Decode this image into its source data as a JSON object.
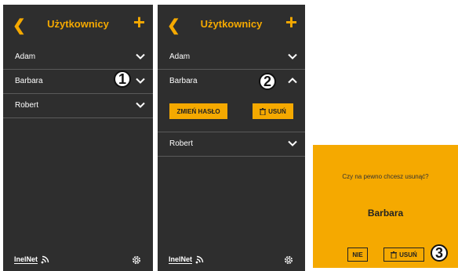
{
  "screen": {
    "title": "Użytkownicy",
    "back_icon": "chevron-left-icon",
    "add_icon": "plus-icon",
    "users": [
      "Adam",
      "Barbara",
      "Robert"
    ],
    "footer_logo": "InelNet",
    "settings_icon": "gear-icon"
  },
  "expanded": {
    "change_password_label": "ZMIEŃ HASŁO",
    "delete_label": "USUŃ"
  },
  "dialog": {
    "question": "Czy na pewno chcesz usunąć?",
    "user_name": "Barbara",
    "no_label": "NIE",
    "delete_label": "USUŃ"
  },
  "steps": [
    "1",
    "2",
    "3"
  ],
  "colors": {
    "accent": "#f5a900",
    "panel": "#2e2e2e"
  }
}
